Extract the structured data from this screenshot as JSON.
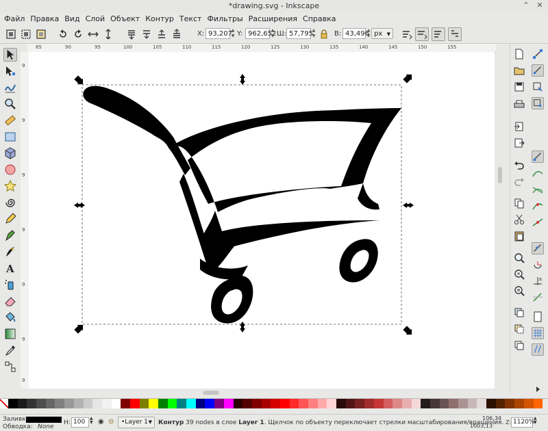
{
  "window": {
    "title": "*drawing.svg - Inkscape",
    "buttons": [
      "⌃",
      "✕"
    ]
  },
  "menu": [
    "Файл",
    "Правка",
    "Вид",
    "Слой",
    "Объект",
    "Контур",
    "Текст",
    "Фильтры",
    "Расширения",
    "Справка"
  ],
  "toolbar": {
    "x_label": "X:",
    "x_value": "93,207",
    "y_label": "Y:",
    "y_value": "962,652",
    "w_label": "Ш:",
    "w_value": "57,795",
    "h_label": "В:",
    "h_value": "43,496",
    "unit": "px",
    "icons": [
      "select-all-icon",
      "select-all-layers-icon",
      "deselect-icon",
      "rotate-ccw-icon",
      "rotate-cw-icon",
      "flip-horizontal-icon",
      "flip-vertical-icon",
      "raise-to-bottom-icon",
      "lower-icon",
      "raise-icon",
      "raise-to-top-icon",
      "lock-ratio-icon",
      "scale-stroke-icon",
      "scale-corners-icon",
      "move-gradients-icon",
      "move-patterns-icon"
    ]
  },
  "ruler_top_labels": [
    "85",
    "90",
    "95",
    "100",
    "105",
    "110",
    "115",
    "120",
    "125",
    "130",
    "135",
    "140",
    "145",
    "150",
    "155"
  ],
  "ruler_left_labels": [
    "9",
    "9",
    "9",
    "9",
    "9",
    "9",
    "9"
  ],
  "tools": [
    "selector-icon",
    "node-editor-icon",
    "tweak-icon",
    "zoom-icon",
    "measure-icon",
    "rectangle-icon",
    "3d-box-icon",
    "ellipse-icon",
    "star-icon",
    "spiral-icon",
    "pencil-icon",
    "pen-icon",
    "calligraphy-icon",
    "text-icon",
    "spray-icon",
    "eraser-icon",
    "bucket-icon",
    "gradient-icon",
    "dropper-icon",
    "connector-icon"
  ],
  "commands": [
    "new-document-icon",
    "open-icon",
    "save-icon",
    "print-icon",
    "import-icon",
    "export-icon",
    "undo-icon",
    "redo-icon",
    "copy-icon",
    "cut-icon",
    "paste-icon",
    "zoom-selection-icon",
    "zoom-drawing-icon",
    "zoom-page-icon",
    "duplicate-icon",
    "clone-icon",
    "unlink-clone-icon"
  ],
  "snaps": [
    "snap-toggle-icon",
    "snap-bbox-icon",
    "snap-bbox-edge-icon",
    "snap-bbox-corner-icon",
    "snap-nodes-icon",
    "snap-path-icon",
    "snap-intersection-icon",
    "snap-smooth-icon",
    "snap-midpoint-icon",
    "snap-center-icon",
    "snap-rotation-icon",
    "snap-page-icon",
    "snap-grid-icon",
    "snap-guide-icon"
  ],
  "palette_colors": [
    "#000000",
    "#1a1a1a",
    "#333333",
    "#4d4d4d",
    "#666666",
    "#808080",
    "#999999",
    "#b3b3b3",
    "#cccccc",
    "#e6e6e6",
    "#f2f2f2",
    "#ffffff",
    "#800000",
    "#ff0000",
    "#808000",
    "#ffff00",
    "#008000",
    "#00ff00",
    "#008080",
    "#00ffff",
    "#000080",
    "#0000ff",
    "#800080",
    "#ff00ff",
    "#2b0000",
    "#550000",
    "#800000",
    "#aa0000",
    "#d40000",
    "#ff0000",
    "#ff2a2a",
    "#ff5555",
    "#ff8080",
    "#ffaaaa",
    "#ffd5d5",
    "#280b0b",
    "#501616",
    "#782121",
    "#a02c2c",
    "#c83737",
    "#d35f5f",
    "#de8787",
    "#e9afaf",
    "#f4d7d7",
    "#241c1c",
    "#483737",
    "#6c5353",
    "#916f6f",
    "#ac9393",
    "#c8b7b7",
    "#e3dbdb",
    "#2b1100",
    "#552200",
    "#803300",
    "#aa4400",
    "#d45500",
    "#ff6600"
  ],
  "status": {
    "fill_label": "Заливка:",
    "stroke_label": "Обводка:",
    "fill_value": "",
    "stroke_value": "None",
    "h_label": "Н:",
    "opacity": "100",
    "layer": "•Layer 1",
    "message_bold1": "Контур",
    "message_part1": " 39 nodes в слое ",
    "message_bold2": "Layer 1",
    "message_part2": ". Щелчок по объекту переключает стрелки масштабирования/вращения.",
    "cursor_x": "106,34",
    "cursor_y": "1003,13",
    "z_label": "Z:",
    "zoom": "1120%"
  }
}
